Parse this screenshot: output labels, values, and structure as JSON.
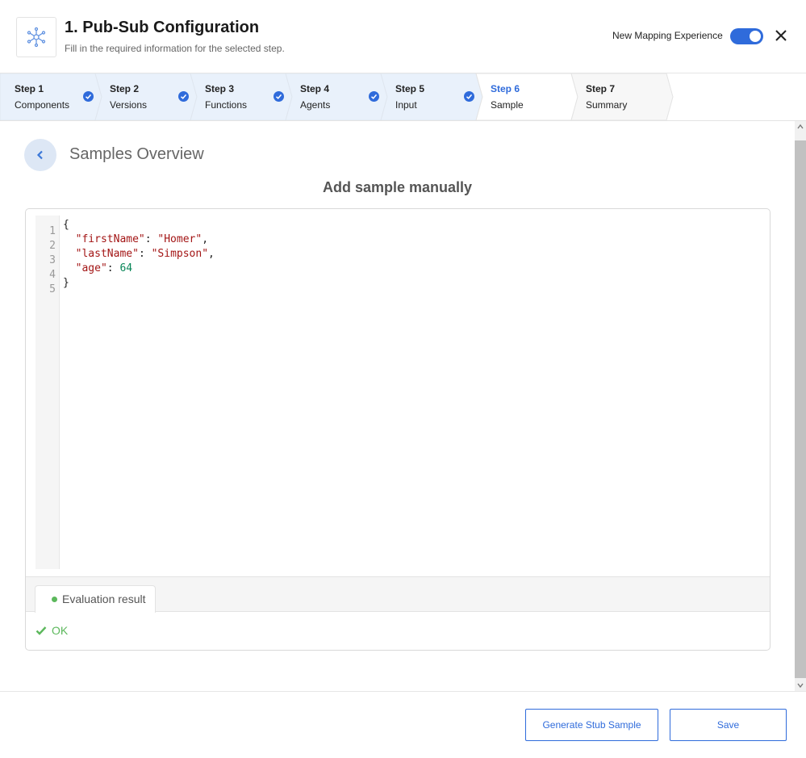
{
  "header": {
    "title": "1. Pub-Sub Configuration",
    "subtitle": "Fill in the required information for the selected step.",
    "toggle_label": "New Mapping Experience",
    "toggle_on": true,
    "accent_color": "#2f6bdb"
  },
  "steps": [
    {
      "title": "Step 1",
      "label": "Components",
      "completed": true
    },
    {
      "title": "Step 2",
      "label": "Versions",
      "completed": true
    },
    {
      "title": "Step 3",
      "label": "Functions",
      "completed": true
    },
    {
      "title": "Step 4",
      "label": "Agents",
      "completed": true
    },
    {
      "title": "Step 5",
      "label": "Input",
      "completed": true
    },
    {
      "title": "Step 6",
      "label": "Sample",
      "active": true
    },
    {
      "title": "Step 7",
      "label": "Summary"
    }
  ],
  "main": {
    "section_title": "Samples Overview",
    "editor_heading": "Add sample manually",
    "code_lines": [
      {
        "n": "1",
        "text": "{"
      },
      {
        "n": "2",
        "text": "  \"firstName\": \"Homer\","
      },
      {
        "n": "3",
        "text": "  \"lastName\": \"Simpson\","
      },
      {
        "n": "4",
        "text": "  \"age\": 64"
      },
      {
        "n": "5",
        "text": "}"
      }
    ],
    "result_tab_label": "Evaluation result",
    "result_status": "OK",
    "status_color": "#5cb85c"
  },
  "footer": {
    "generate_label": "Generate Stub Sample",
    "save_label": "Save"
  }
}
